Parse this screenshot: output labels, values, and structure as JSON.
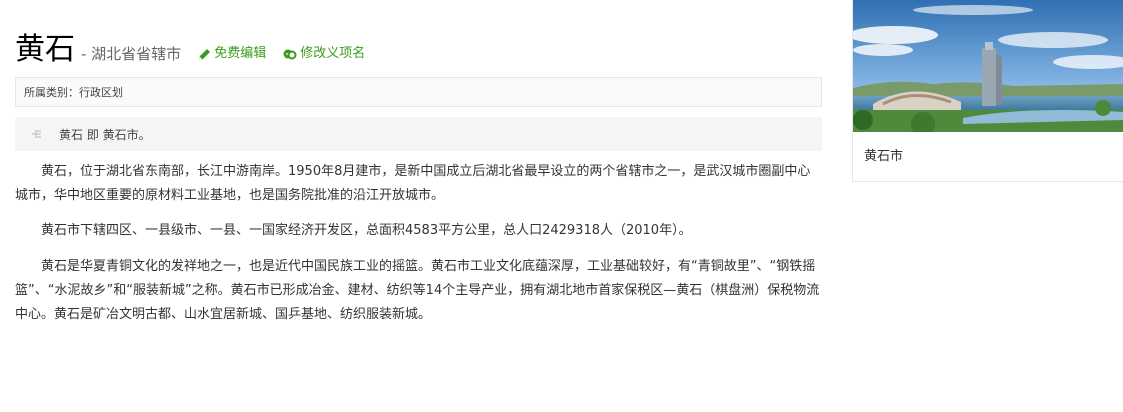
{
  "header": {
    "title": "黄石",
    "subtitle": "- 湖北省省辖市",
    "edit_label": "免费编辑",
    "rename_label": "修改义项名"
  },
  "category": {
    "text": "所属类别：行政区划"
  },
  "polysemy": {
    "text": "黄石 即 黄石市。"
  },
  "paragraphs": {
    "p1": "黄石，位于湖北省东南部，长江中游南岸。1950年8月建市，是新中国成立后湖北省最早设立的两个省辖市之一，是武汉城市圈副中心城市，华中地区重要的原材料工业基地，也是国务院批准的沿江开放城市。",
    "p2": "黄石市下辖四区、一县级市、一县、一国家经济开发区，总面积4583平方公里，总人口2429318人（2010年）。",
    "p3": "黄石是华夏青铜文化的发祥地之一，也是近代中国民族工业的摇篮。黄石市工业文化底蕴深厚，工业基础较好，有“青铜故里”、“钢铁摇篮”、“水泥故乡”和“服装新城”之称。黄石市已形成冶金、建材、纺织等14个主导产业，拥有湖北地市首家保税区—黄石（棋盘洲）保税物流中心。黄石是矿冶文明古都、山水宜居新城、国乒基地、纺织服装新城。"
  },
  "sidebar": {
    "caption": "黄石市"
  },
  "colors": {
    "accent_green": "#3a9c1a"
  },
  "icons": {
    "edit": "pencil-icon",
    "rename": "rename-icon",
    "polysemy": "polysemy-icon"
  }
}
